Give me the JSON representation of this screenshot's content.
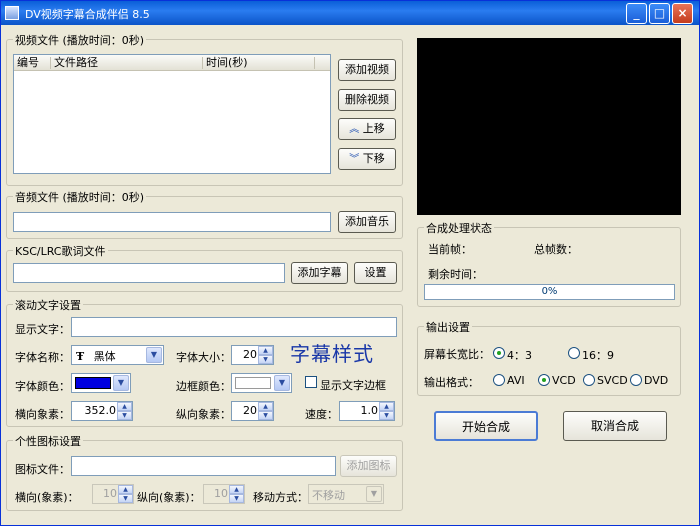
{
  "window": {
    "title": "DV视频字幕合成伴侣 8.5",
    "minimize": "_",
    "maximize": "□",
    "close": "×"
  },
  "video_group": {
    "title": "视频文件 (播放时间：0秒)",
    "columns": [
      "编号",
      "文件路径",
      "时间(秒)"
    ],
    "rows": [],
    "add_button": "添加视频",
    "delete_button": "删除视频",
    "up_button": "上移",
    "down_button": "下移"
  },
  "audio_group": {
    "title": "音频文件 (播放时间：0秒)",
    "file_value": "",
    "add_button": "添加音乐"
  },
  "lyrics_group": {
    "title": "KSC/LRC歌词文件",
    "file_value": "",
    "add_button": "添加字幕",
    "settings_button": "设置"
  },
  "scroll_text_group": {
    "title": "滚动文字设置",
    "display_text_label": "显示文字：",
    "display_text_value": "",
    "font_name_label": "字体名称：",
    "font_name_value": "黑体",
    "font_icon": "Ŧ",
    "font_size_label": "字体大小：",
    "font_size_value": "20",
    "sample_text": "字幕样式",
    "font_color_label": "字体颜色：",
    "font_color": "#0000e0",
    "border_color_label": "边框颜色：",
    "border_color": "#ffffff",
    "show_border_label": "显示文字边框",
    "show_border_checked": false,
    "h_pixels_label": "横向象素：",
    "h_pixels_value": "352.0",
    "v_pixels_label": "纵向象素：",
    "v_pixels_value": "20",
    "speed_label": "速度：",
    "speed_value": "1.0"
  },
  "logo_group": {
    "title": "个性图标设置",
    "file_label": "图标文件：",
    "file_value": "",
    "add_button": "添加图标",
    "h_label": "横向(象素)：",
    "h_value": "10",
    "v_label": "纵向(象素)：",
    "v_value": "10",
    "move_label": "移动方式：",
    "move_value": "不移动"
  },
  "status_group": {
    "title": "合成处理状态",
    "current_frame_label": "当前帧：",
    "total_frames_label": "总帧数：",
    "remaining_label": "剩余时间：",
    "progress_text": "0%",
    "progress_fraction": 0
  },
  "output_group": {
    "title": "输出设置",
    "aspect_label": "屏幕长宽比：",
    "aspect_options": [
      "4：3",
      "16：9"
    ],
    "aspect_selected": "4：3",
    "format_label": "输出格式：",
    "format_options": [
      "AVI",
      "VCD",
      "SVCD",
      "DVD"
    ],
    "format_selected": "VCD"
  },
  "actions": {
    "start_button": "开始合成",
    "cancel_button": "取消合成"
  },
  "colors": {
    "titlebar": "#0a5fd8",
    "window_bg": "#ece9d8",
    "preview_bg": "#000000",
    "sample_text": "#1937a8"
  }
}
